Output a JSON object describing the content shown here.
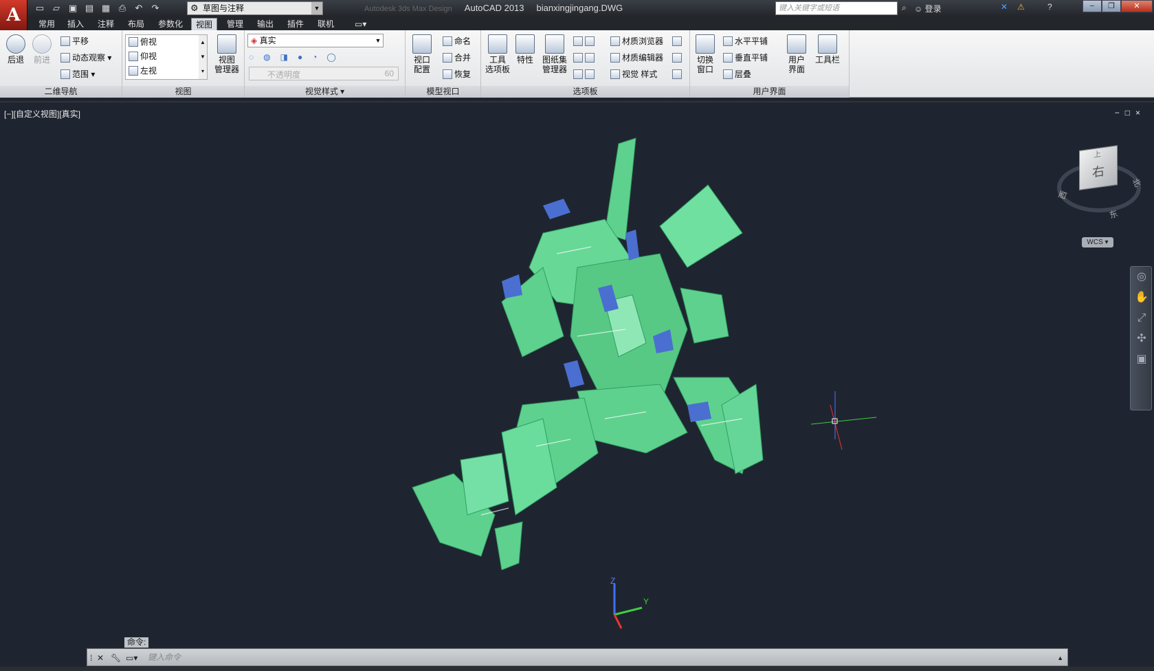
{
  "app": {
    "logo": "A",
    "title": "AutoCAD 2013",
    "filename": "bianxingjingang.DWG",
    "faded_title": "Autodesk 3ds Max Design"
  },
  "workspace": {
    "value": "草图与注释"
  },
  "search": {
    "placeholder": "键入关键字或短语"
  },
  "login": {
    "label": "登录"
  },
  "tabs": [
    {
      "label": "常用"
    },
    {
      "label": "插入"
    },
    {
      "label": "注释"
    },
    {
      "label": "布局"
    },
    {
      "label": "参数化"
    },
    {
      "label": "视图"
    },
    {
      "label": "管理"
    },
    {
      "label": "输出"
    },
    {
      "label": "插件"
    },
    {
      "label": "联机"
    }
  ],
  "panels": {
    "nav2d": {
      "title": "二维导航",
      "back": "后退",
      "forward": "前进",
      "pan": "平移",
      "orbit": "动态观察",
      "extents": "范围"
    },
    "views": {
      "title": "视图",
      "items": [
        "俯视",
        "仰视",
        "左视"
      ],
      "manager_line1": "视图",
      "manager_line2": "管理器"
    },
    "visual_styles": {
      "title": "视觉样式",
      "style": "真实",
      "opacity_label": "不透明度",
      "opacity_value": "60"
    },
    "model_viewports": {
      "title": "模型视口",
      "config_line1": "视口",
      "config_line2": "配置",
      "named": "命名",
      "join": "合并",
      "restore": "恢复"
    },
    "palettes": {
      "title": "选项板",
      "tool_line1": "工具",
      "tool_line2": "选项板",
      "properties": "特性",
      "sheetset_line1": "图纸集",
      "sheetset_line2": "管理器",
      "mat_browser": "材质浏览器",
      "mat_editor": "材质编辑器",
      "visual_styles": "视觉 样式"
    },
    "ui": {
      "title": "用户界面",
      "switch_line1": "切换",
      "switch_line2": "窗口",
      "tile_h": "水平平铺",
      "tile_v": "垂直平铺",
      "cascade": "层叠",
      "userif_line1": "用户",
      "userif_line2": "界面",
      "toolbars": "工具栏"
    }
  },
  "viewport": {
    "label": "[−][自定义视图][真实]",
    "controls": "−□×"
  },
  "viewcube": {
    "face": "右",
    "top": "上",
    "north": "北",
    "east": "东",
    "west": "西",
    "wcs": "WCS"
  },
  "ucs": {
    "z": "Z",
    "y": "Y"
  },
  "command": {
    "label": "命令:",
    "placeholder": "键入命令"
  },
  "colors": {
    "model": "#5fd18e",
    "model_dark": "#2f9e62",
    "accent_blue": "#4a6fd1",
    "background": "#1f2530"
  }
}
